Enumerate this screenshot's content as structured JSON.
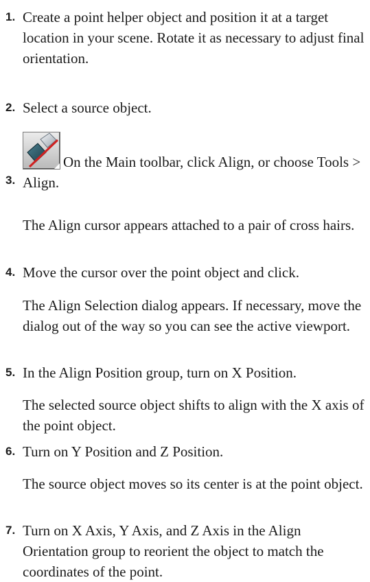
{
  "steps": [
    {
      "number": "1.",
      "text": "Create a point helper object and position it at a target location in your scene.  Rotate it as necessary to adjust final orientation."
    },
    {
      "number": "2.",
      "text": "Select a source object."
    },
    {
      "number": "3.",
      "text": "On the Main toolbar, click Align, or choose Tools > Align.",
      "icon": "align-tool-icon",
      "note": "The Align cursor appears attached to a pair of cross hairs."
    },
    {
      "number": "4.",
      "text": "Move the cursor over the point object and click.",
      "note": "The Align Selection dialog appears.  If necessary, move the dialog out of the way so you can see the active viewport."
    },
    {
      "number": "5.",
      "text": "In the Align Position group, turn on X Position.",
      "note": "The selected source object shifts to align with the X axis of the point object."
    },
    {
      "number": "6.",
      "text": "Turn on Y Position and Z Position.",
      "note": "The source object moves so its center is at the point object."
    },
    {
      "number": "7.",
      "text": "Turn on X Axis, Y Axis, and Z Axis in the Align Orientation group to reorient the object to match the coordinates of the point."
    }
  ]
}
